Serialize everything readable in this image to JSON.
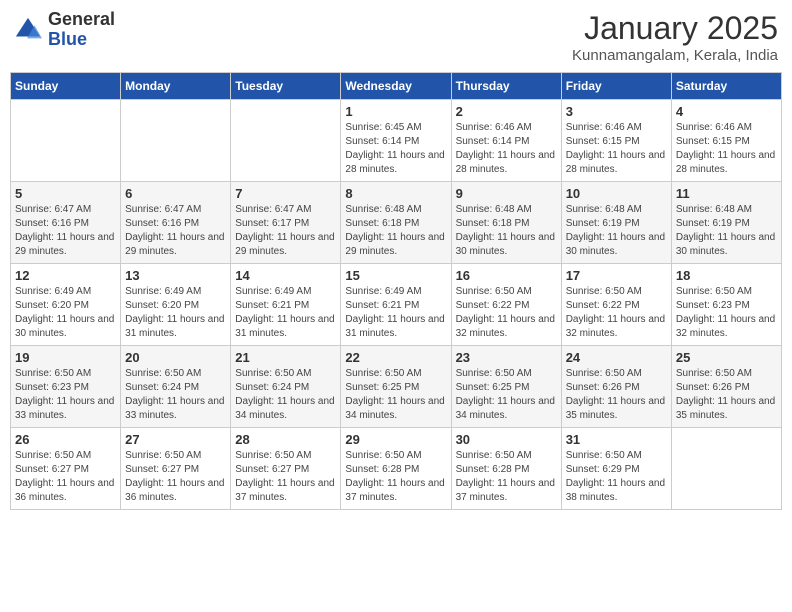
{
  "logo": {
    "general": "General",
    "blue": "Blue"
  },
  "header": {
    "month": "January 2025",
    "location": "Kunnamangalam, Kerala, India"
  },
  "weekdays": [
    "Sunday",
    "Monday",
    "Tuesday",
    "Wednesday",
    "Thursday",
    "Friday",
    "Saturday"
  ],
  "weeks": [
    [
      {
        "day": "",
        "sunrise": "",
        "sunset": "",
        "daylight": ""
      },
      {
        "day": "",
        "sunrise": "",
        "sunset": "",
        "daylight": ""
      },
      {
        "day": "",
        "sunrise": "",
        "sunset": "",
        "daylight": ""
      },
      {
        "day": "1",
        "sunrise": "Sunrise: 6:45 AM",
        "sunset": "Sunset: 6:14 PM",
        "daylight": "Daylight: 11 hours and 28 minutes."
      },
      {
        "day": "2",
        "sunrise": "Sunrise: 6:46 AM",
        "sunset": "Sunset: 6:14 PM",
        "daylight": "Daylight: 11 hours and 28 minutes."
      },
      {
        "day": "3",
        "sunrise": "Sunrise: 6:46 AM",
        "sunset": "Sunset: 6:15 PM",
        "daylight": "Daylight: 11 hours and 28 minutes."
      },
      {
        "day": "4",
        "sunrise": "Sunrise: 6:46 AM",
        "sunset": "Sunset: 6:15 PM",
        "daylight": "Daylight: 11 hours and 28 minutes."
      }
    ],
    [
      {
        "day": "5",
        "sunrise": "Sunrise: 6:47 AM",
        "sunset": "Sunset: 6:16 PM",
        "daylight": "Daylight: 11 hours and 29 minutes."
      },
      {
        "day": "6",
        "sunrise": "Sunrise: 6:47 AM",
        "sunset": "Sunset: 6:16 PM",
        "daylight": "Daylight: 11 hours and 29 minutes."
      },
      {
        "day": "7",
        "sunrise": "Sunrise: 6:47 AM",
        "sunset": "Sunset: 6:17 PM",
        "daylight": "Daylight: 11 hours and 29 minutes."
      },
      {
        "day": "8",
        "sunrise": "Sunrise: 6:48 AM",
        "sunset": "Sunset: 6:18 PM",
        "daylight": "Daylight: 11 hours and 29 minutes."
      },
      {
        "day": "9",
        "sunrise": "Sunrise: 6:48 AM",
        "sunset": "Sunset: 6:18 PM",
        "daylight": "Daylight: 11 hours and 30 minutes."
      },
      {
        "day": "10",
        "sunrise": "Sunrise: 6:48 AM",
        "sunset": "Sunset: 6:19 PM",
        "daylight": "Daylight: 11 hours and 30 minutes."
      },
      {
        "day": "11",
        "sunrise": "Sunrise: 6:48 AM",
        "sunset": "Sunset: 6:19 PM",
        "daylight": "Daylight: 11 hours and 30 minutes."
      }
    ],
    [
      {
        "day": "12",
        "sunrise": "Sunrise: 6:49 AM",
        "sunset": "Sunset: 6:20 PM",
        "daylight": "Daylight: 11 hours and 30 minutes."
      },
      {
        "day": "13",
        "sunrise": "Sunrise: 6:49 AM",
        "sunset": "Sunset: 6:20 PM",
        "daylight": "Daylight: 11 hours and 31 minutes."
      },
      {
        "day": "14",
        "sunrise": "Sunrise: 6:49 AM",
        "sunset": "Sunset: 6:21 PM",
        "daylight": "Daylight: 11 hours and 31 minutes."
      },
      {
        "day": "15",
        "sunrise": "Sunrise: 6:49 AM",
        "sunset": "Sunset: 6:21 PM",
        "daylight": "Daylight: 11 hours and 31 minutes."
      },
      {
        "day": "16",
        "sunrise": "Sunrise: 6:50 AM",
        "sunset": "Sunset: 6:22 PM",
        "daylight": "Daylight: 11 hours and 32 minutes."
      },
      {
        "day": "17",
        "sunrise": "Sunrise: 6:50 AM",
        "sunset": "Sunset: 6:22 PM",
        "daylight": "Daylight: 11 hours and 32 minutes."
      },
      {
        "day": "18",
        "sunrise": "Sunrise: 6:50 AM",
        "sunset": "Sunset: 6:23 PM",
        "daylight": "Daylight: 11 hours and 32 minutes."
      }
    ],
    [
      {
        "day": "19",
        "sunrise": "Sunrise: 6:50 AM",
        "sunset": "Sunset: 6:23 PM",
        "daylight": "Daylight: 11 hours and 33 minutes."
      },
      {
        "day": "20",
        "sunrise": "Sunrise: 6:50 AM",
        "sunset": "Sunset: 6:24 PM",
        "daylight": "Daylight: 11 hours and 33 minutes."
      },
      {
        "day": "21",
        "sunrise": "Sunrise: 6:50 AM",
        "sunset": "Sunset: 6:24 PM",
        "daylight": "Daylight: 11 hours and 34 minutes."
      },
      {
        "day": "22",
        "sunrise": "Sunrise: 6:50 AM",
        "sunset": "Sunset: 6:25 PM",
        "daylight": "Daylight: 11 hours and 34 minutes."
      },
      {
        "day": "23",
        "sunrise": "Sunrise: 6:50 AM",
        "sunset": "Sunset: 6:25 PM",
        "daylight": "Daylight: 11 hours and 34 minutes."
      },
      {
        "day": "24",
        "sunrise": "Sunrise: 6:50 AM",
        "sunset": "Sunset: 6:26 PM",
        "daylight": "Daylight: 11 hours and 35 minutes."
      },
      {
        "day": "25",
        "sunrise": "Sunrise: 6:50 AM",
        "sunset": "Sunset: 6:26 PM",
        "daylight": "Daylight: 11 hours and 35 minutes."
      }
    ],
    [
      {
        "day": "26",
        "sunrise": "Sunrise: 6:50 AM",
        "sunset": "Sunset: 6:27 PM",
        "daylight": "Daylight: 11 hours and 36 minutes."
      },
      {
        "day": "27",
        "sunrise": "Sunrise: 6:50 AM",
        "sunset": "Sunset: 6:27 PM",
        "daylight": "Daylight: 11 hours and 36 minutes."
      },
      {
        "day": "28",
        "sunrise": "Sunrise: 6:50 AM",
        "sunset": "Sunset: 6:27 PM",
        "daylight": "Daylight: 11 hours and 37 minutes."
      },
      {
        "day": "29",
        "sunrise": "Sunrise: 6:50 AM",
        "sunset": "Sunset: 6:28 PM",
        "daylight": "Daylight: 11 hours and 37 minutes."
      },
      {
        "day": "30",
        "sunrise": "Sunrise: 6:50 AM",
        "sunset": "Sunset: 6:28 PM",
        "daylight": "Daylight: 11 hours and 37 minutes."
      },
      {
        "day": "31",
        "sunrise": "Sunrise: 6:50 AM",
        "sunset": "Sunset: 6:29 PM",
        "daylight": "Daylight: 11 hours and 38 minutes."
      },
      {
        "day": "",
        "sunrise": "",
        "sunset": "",
        "daylight": ""
      }
    ]
  ]
}
